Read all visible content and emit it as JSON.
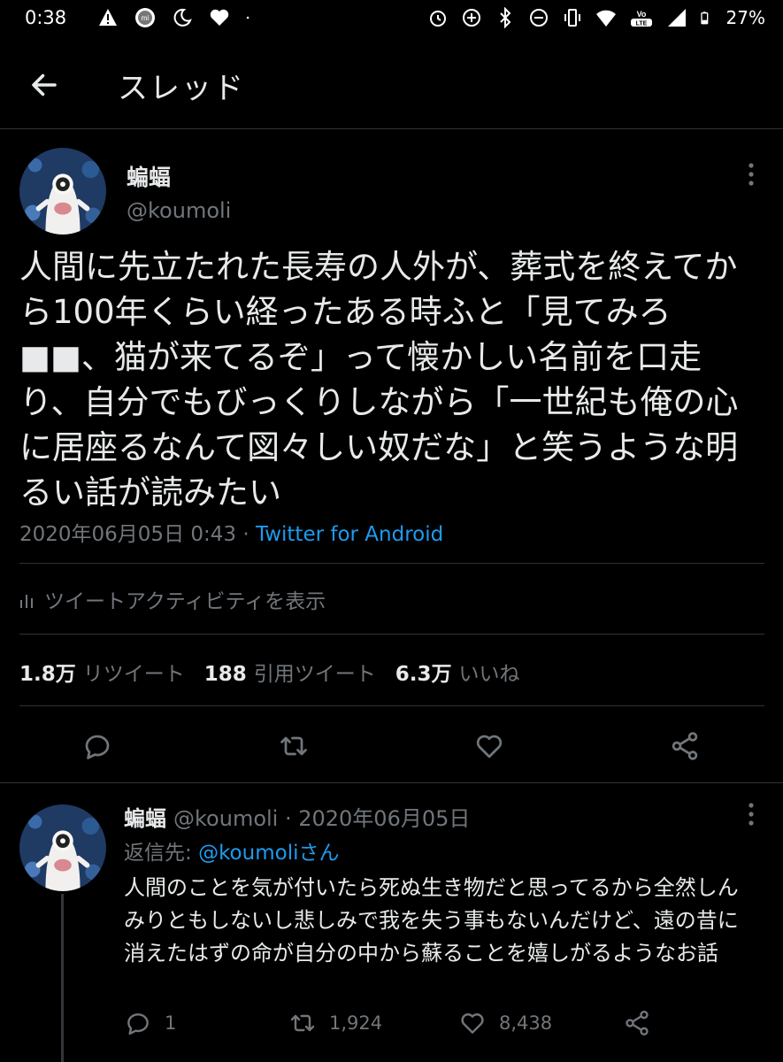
{
  "status_bar": {
    "time": "0:38",
    "battery": "27%",
    "left_icons": [
      "alert-icon",
      "mi-icon",
      "sleep-icon",
      "heart-icon",
      "dot-icon"
    ],
    "right_icons": [
      "alarm-icon",
      "data-saver-icon",
      "bluetooth-icon",
      "dnd-icon",
      "vibrate-icon",
      "wifi-icon",
      "volte-icon",
      "signal-icon",
      "battery-icon"
    ]
  },
  "header": {
    "title": "スレッド"
  },
  "tweet": {
    "display_name": "蝙蝠",
    "handle": "@koumoli",
    "text": "人間に先立たれた長寿の人外が、葬式を終えてから100年くらい経ったある時ふと「見てみろ■■、猫が来てるぞ」って懐かしい名前を口走り、自分でもびっくりしながら「一世紀も俺の心に居座るなんて図々しい奴だな」と笑うような明るい話が読みたい",
    "date": "2020年06月05日 0:43 · ",
    "source": "Twitter for Android",
    "activity_label": "ツイートアクティビティを表示",
    "stats": [
      {
        "num": "1.8万",
        "label": "リツイート"
      },
      {
        "num": "188",
        "label": "引用ツイート"
      },
      {
        "num": "6.3万",
        "label": "いいね"
      }
    ]
  },
  "reply": {
    "display_name": "蝙蝠",
    "handle_date": "@koumoli · 2020年06月05日",
    "reply_to_prefix": "返信先: ",
    "reply_to_mention": "@koumoliさん",
    "text": "人間のことを気が付いたら死ぬ生き物だと思ってるから全然しんみりともしないし悲しみで我を失う事もないんだけど、遠の昔に消えたはずの命が自分の中から蘇ることを嬉しがるようなお話",
    "replies": "1",
    "retweets": "1,924",
    "likes": "8,438"
  },
  "colors": {
    "background": "#000000",
    "text": "#e7e9ea",
    "muted": "#71767b",
    "accent": "#1d9bf0",
    "divider": "#2f3336"
  }
}
